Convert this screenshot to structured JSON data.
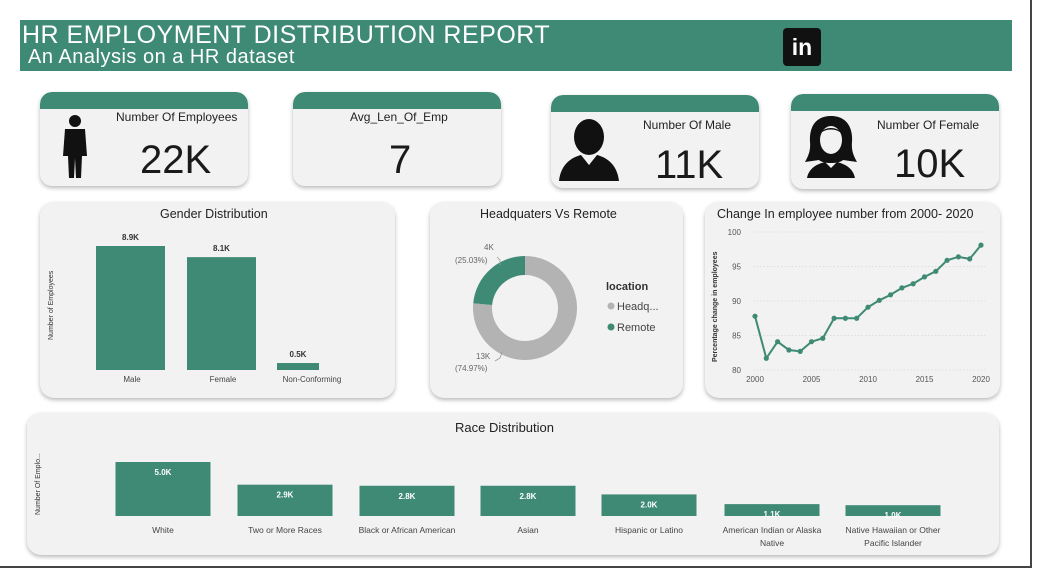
{
  "header": {
    "title": "HR EMPLOYMENT DISTRIBUTION REPORT",
    "subtitle": "An Analysis on a HR dataset",
    "logo_text": "in"
  },
  "kpis": [
    {
      "label": "Number Of Employees",
      "value": "22K",
      "icon": "person-standing-icon"
    },
    {
      "label": "Avg_Len_Of_Emp",
      "value": "7"
    },
    {
      "label": "Number Of Male",
      "value": "11K",
      "icon": "male-avatar-icon"
    },
    {
      "label": "Number Of Female",
      "value": "10K",
      "icon": "female-avatar-icon"
    }
  ],
  "colors": {
    "accent": "#3f8a74",
    "grey": "#b3b3b3",
    "panel": "#f2f2f2"
  },
  "gender": {
    "title": "Gender Distribution",
    "ylabel": "Number of Employees"
  },
  "hq": {
    "title": "Headquaters Vs Remote",
    "legend_title": "location",
    "legend": [
      "Headq...",
      "Remote"
    ],
    "remote_label": "4K",
    "remote_pct": "(25.03%)",
    "hq_label": "13K",
    "hq_pct": "(74.97%)"
  },
  "trend": {
    "title": "Change In employee number from 2000- 2020",
    "ylabel": "Percentage change in employees"
  },
  "race": {
    "title": "Race Distribution",
    "ylabel": "Number Of Emplo..."
  },
  "chart_data": [
    {
      "type": "bar",
      "title": "Gender Distribution",
      "ylabel": "Number of Employees",
      "categories": [
        "Male",
        "Female",
        "Non-Conforming"
      ],
      "values": [
        8900,
        8100,
        500
      ],
      "data_labels": [
        "8.9K",
        "8.1K",
        "0.5K"
      ]
    },
    {
      "type": "pie",
      "title": "Headquaters Vs Remote",
      "categories": [
        "Headquarters",
        "Remote"
      ],
      "values": [
        13000,
        4000
      ],
      "percent": [
        74.97,
        25.03
      ],
      "colors": [
        "#b3b3b3",
        "#3f8a74"
      ]
    },
    {
      "type": "line",
      "title": "Change In employee number from 2000- 2020",
      "ylabel": "Percentage change in employees",
      "x": [
        2000,
        2001,
        2002,
        2003,
        2004,
        2005,
        2006,
        2007,
        2008,
        2009,
        2010,
        2011,
        2012,
        2013,
        2014,
        2015,
        2016,
        2017,
        2018,
        2019,
        2020
      ],
      "y": [
        87.8,
        81.7,
        84.1,
        82.9,
        82.7,
        84.1,
        84.6,
        87.5,
        87.5,
        87.5,
        89.1,
        90.1,
        90.9,
        91.9,
        92.5,
        93.5,
        94.3,
        95.9,
        96.4,
        96.1,
        98.1
      ],
      "xticks": [
        2000,
        2005,
        2010,
        2015,
        2020
      ],
      "yticks": [
        80,
        85,
        90,
        95,
        100
      ],
      "ylim": [
        80,
        100
      ]
    },
    {
      "type": "bar",
      "title": "Race Distribution",
      "ylabel": "Number Of Emplo...",
      "categories": [
        "White",
        "Two or More Races",
        "Black or African American",
        "Asian",
        "Hispanic or Latino",
        "American Indian or Alaska Native",
        "Native Hawaiian or Other Pacific Islander"
      ],
      "category_lines": [
        [
          "White"
        ],
        [
          "Two or More Races"
        ],
        [
          "Black or African American"
        ],
        [
          "Asian"
        ],
        [
          "Hispanic or Latino"
        ],
        [
          "American Indian or Alaska",
          "Native"
        ],
        [
          "Native Hawaiian or Other",
          "Pacific Islander"
        ]
      ],
      "values": [
        5000,
        2900,
        2800,
        2800,
        2000,
        1100,
        1000
      ],
      "data_labels": [
        "5.0K",
        "2.9K",
        "2.8K",
        "2.8K",
        "2.0K",
        "1.1K",
        "1.0K"
      ]
    }
  ]
}
